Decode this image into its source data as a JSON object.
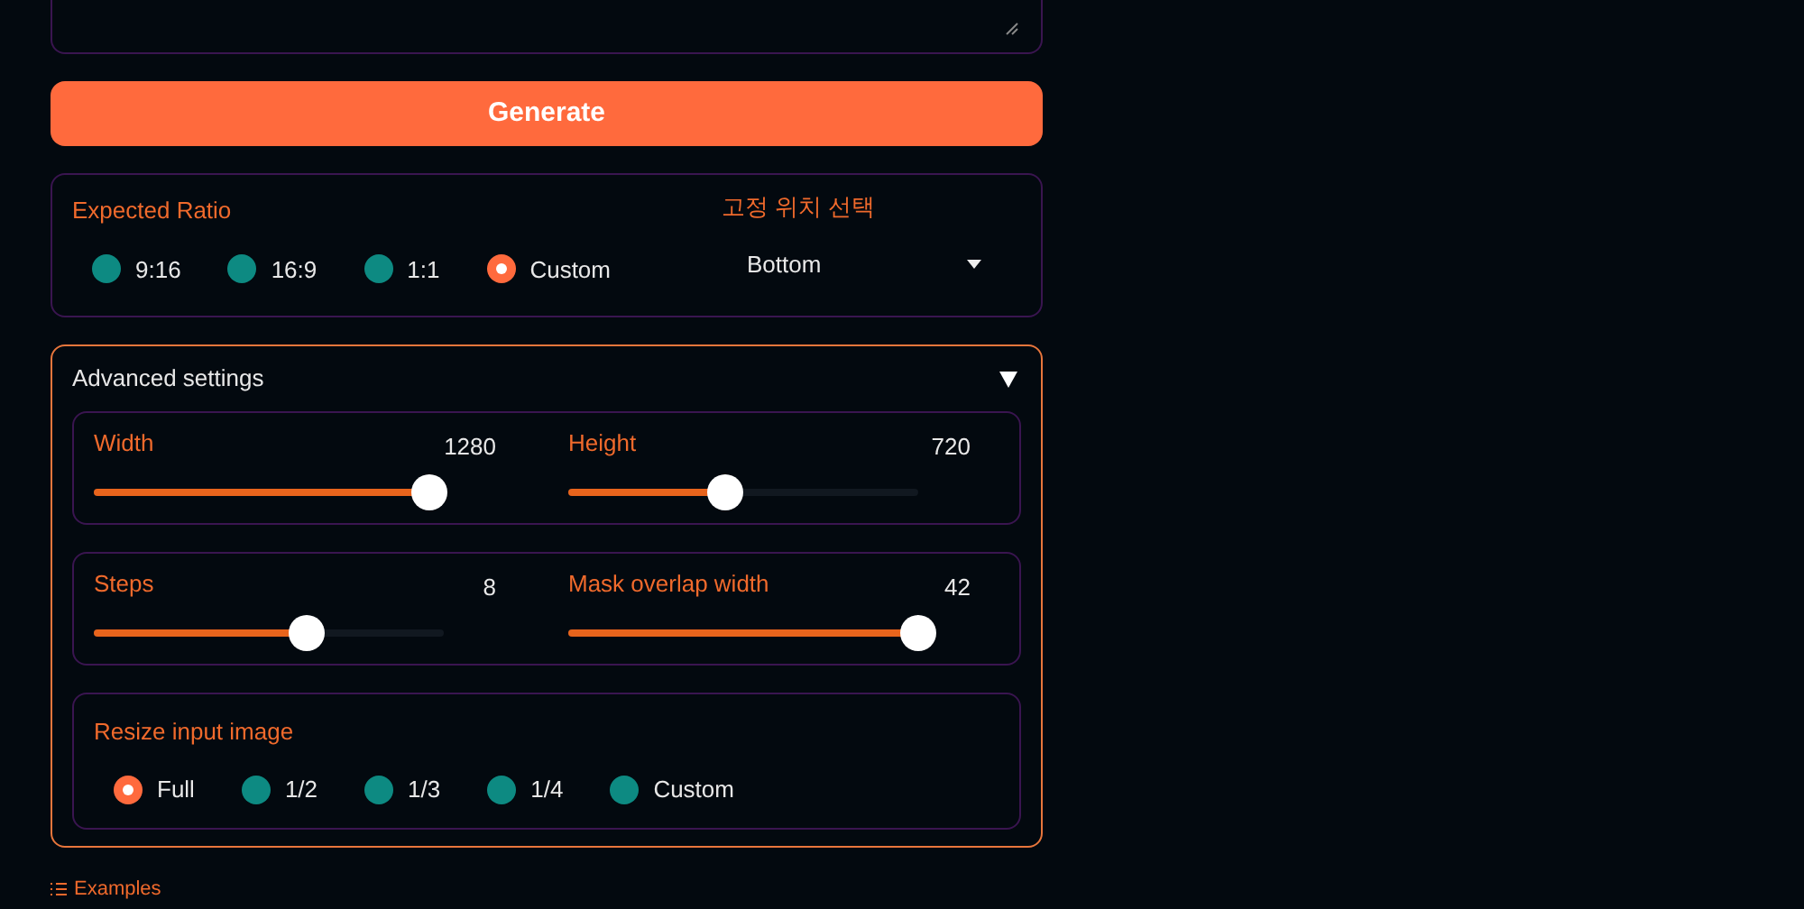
{
  "generate_button": "Generate",
  "ratio": {
    "label": "Expected Ratio",
    "options": [
      {
        "label": "9:16",
        "selected": false
      },
      {
        "label": "16:9",
        "selected": false
      },
      {
        "label": "1:1",
        "selected": false
      },
      {
        "label": "Custom",
        "selected": true
      }
    ]
  },
  "position": {
    "label": "고정 위치 선택",
    "value": "Bottom"
  },
  "advanced": {
    "title": "Advanced settings",
    "expanded": true,
    "slider_groups": [
      [
        {
          "label": "Width",
          "reading": "1280",
          "level": 0.96
        },
        {
          "label": "Height",
          "reading": "720",
          "level": 0.45
        }
      ],
      [
        {
          "label": "Steps",
          "reading": "8",
          "level": 0.61
        },
        {
          "label": "Mask overlap width",
          "reading": "42",
          "level": 1.0
        }
      ]
    ],
    "resize": {
      "label": "Resize input image",
      "options": [
        {
          "label": "Full",
          "selected": true
        },
        {
          "label": "1/2",
          "selected": false
        },
        {
          "label": "1/3",
          "selected": false
        },
        {
          "label": "1/4",
          "selected": false
        },
        {
          "label": "Custom",
          "selected": false
        }
      ]
    }
  },
  "examples": "Examples"
}
